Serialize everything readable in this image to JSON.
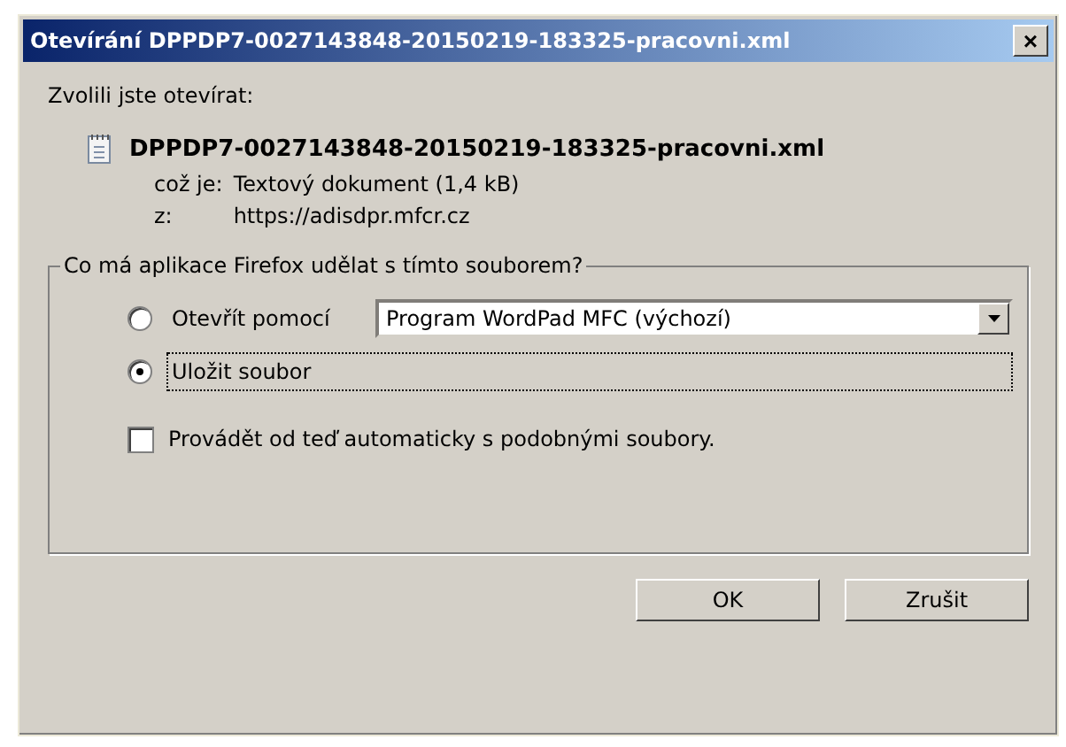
{
  "window": {
    "title": "Otevírání DPPDP7-0027143848-20150219-183325-pracovni.xml",
    "close": "×"
  },
  "intro": "Zvolili jste otevírat:",
  "file": {
    "name": "DPPDP7-0027143848-20150219-183325-pracovni.xml",
    "type_label": "což je:",
    "type": "Textový dokument (1,4 kB)",
    "from_label": "z:",
    "from": "https://adisdpr.mfcr.cz"
  },
  "group": {
    "title": "Co má aplikace Firefox udělat s tímto souborem?",
    "options": [
      {
        "label": "Otevřít pomocí",
        "selected": false,
        "app": "Program WordPad MFC (výchozí)"
      },
      {
        "label": "Uložit soubor",
        "selected": true
      }
    ],
    "remember": {
      "label": "Provádět od teď automaticky s podobnými soubory.",
      "checked": false
    }
  },
  "buttons": [
    "OK",
    "Zrušit"
  ]
}
